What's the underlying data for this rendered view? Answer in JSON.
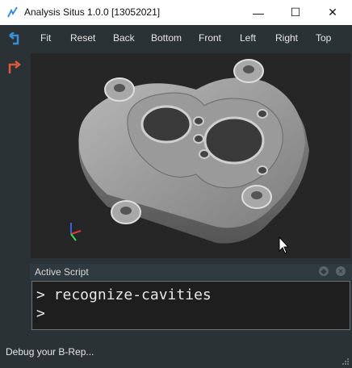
{
  "window": {
    "title": "Analysis Situs 1.0.0 [13052021]",
    "minimize_glyph": "—",
    "maximize_glyph": "☐",
    "close_glyph": "✕"
  },
  "toolbar": {
    "items": [
      "Fit",
      "Reset",
      "Back",
      "Bottom",
      "Front",
      "Left",
      "Right",
      "Top"
    ]
  },
  "icons": {
    "app": "app-logo-icon",
    "toolbar_left": "undo-arrow-icon",
    "side": "redo-arrow-icon",
    "panel_float": "float-icon",
    "panel_close": "close-icon"
  },
  "viewport": {
    "content": "3D CAD part (gray pump housing) with axis triad"
  },
  "script_panel": {
    "title": "Active Script",
    "lines": [
      "> recognize-cavities",
      ">"
    ]
  },
  "status": {
    "text": "Debug your B-Rep..."
  },
  "colors": {
    "chrome": "#2b3236",
    "viewport_bg": "#262626",
    "accent_blue": "#3a8fd8",
    "accent_orange": "#e05a3a"
  }
}
